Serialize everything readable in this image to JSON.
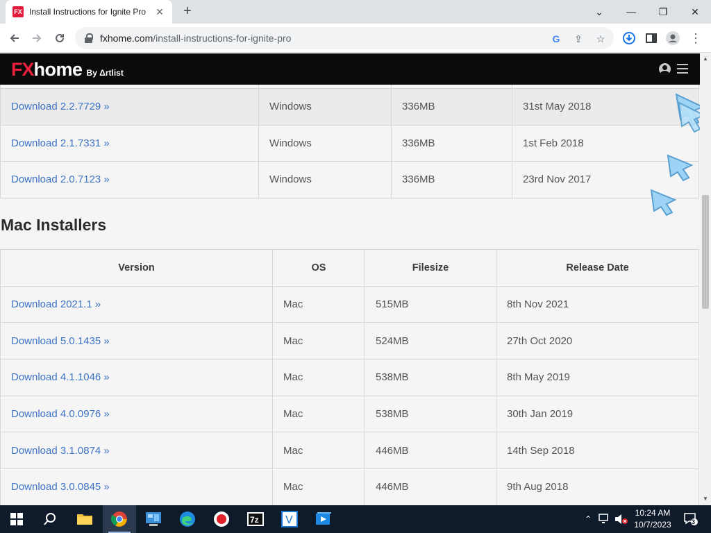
{
  "browser": {
    "tab": {
      "title": "Install Instructions for Ignite Pro",
      "favicon": "FX"
    },
    "url": {
      "domain": "fxhome.com",
      "path": "/install-instructions-for-ignite-pro"
    }
  },
  "site": {
    "logo": {
      "fx": "FX",
      "home": "home",
      "by": "By Δrtlist"
    }
  },
  "windows_installers": {
    "rows": [
      {
        "version": "Download 2.2.7729 »",
        "os": "Windows",
        "size": "336MB",
        "date": "31st May 2018"
      },
      {
        "version": "Download 2.1.7331 »",
        "os": "Windows",
        "size": "336MB",
        "date": "1st Feb 2018"
      },
      {
        "version": "Download 2.0.7123 »",
        "os": "Windows",
        "size": "336MB",
        "date": "23rd Nov 2017"
      }
    ]
  },
  "mac_installers": {
    "title": "Mac Installers",
    "headers": {
      "version": "Version",
      "os": "OS",
      "size": "Filesize",
      "date": "Release Date"
    },
    "rows": [
      {
        "version": "Download 2021.1 »",
        "os": "Mac",
        "size": "515MB",
        "date": "8th Nov 2021"
      },
      {
        "version": "Download 5.0.1435 »",
        "os": "Mac",
        "size": "524MB",
        "date": "27th Oct 2020"
      },
      {
        "version": "Download 4.1.1046 »",
        "os": "Mac",
        "size": "538MB",
        "date": "8th May 2019"
      },
      {
        "version": "Download 4.0.0976 »",
        "os": "Mac",
        "size": "538MB",
        "date": "30th Jan 2019"
      },
      {
        "version": "Download 3.1.0874 »",
        "os": "Mac",
        "size": "446MB",
        "date": "14th Sep 2018"
      },
      {
        "version": "Download 3.0.0845 »",
        "os": "Mac",
        "size": "446MB",
        "date": "9th Aug 2018"
      }
    ]
  },
  "taskbar": {
    "apps": [
      "start",
      "search",
      "file-explorer",
      "chrome",
      "control-panel",
      "edge",
      "recorder",
      "7zip",
      "visual-studio-code",
      "video-player"
    ],
    "clock": {
      "time": "10:24 AM",
      "date": "10/7/2023"
    },
    "notifications_count": "3"
  },
  "colors": {
    "link": "#3f74c5",
    "header_bg": "#0b0b0c",
    "brand_red": "#e8203d"
  }
}
